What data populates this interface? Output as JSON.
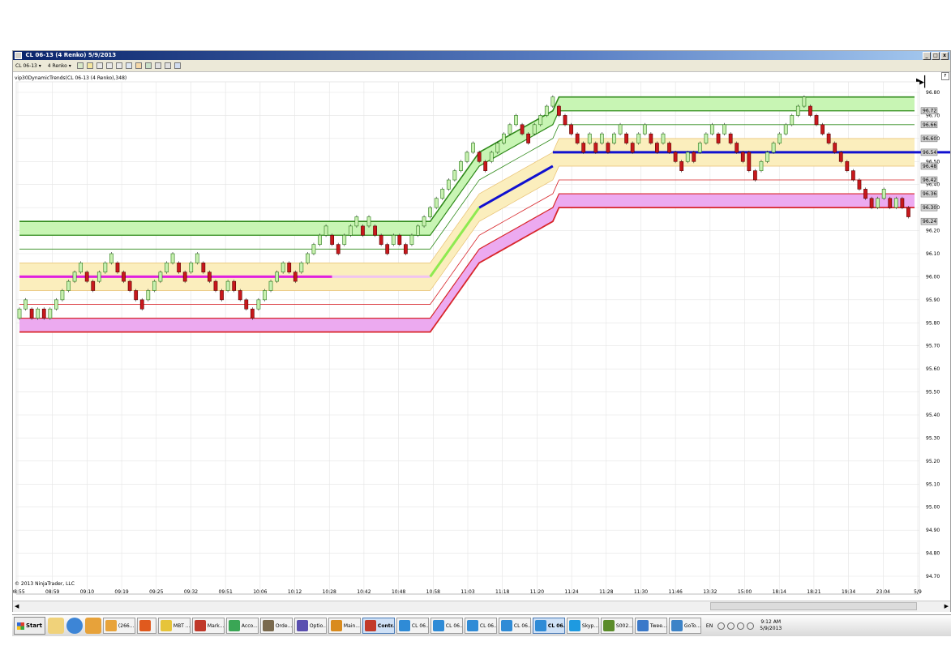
{
  "window": {
    "title": "CL 06-13 (4 Renko)  5/9/2013",
    "controls": [
      "_",
      "□",
      "x"
    ]
  },
  "toolbar": {
    "instrument": "CL 06-13 ▾",
    "bar_type": "4 Renko ▾"
  },
  "indicator_label": "vip30DynamicTrends(CL 06-13 (4 Renko),348)",
  "copyright": "© 2013 NinjaTrader, LLC",
  "nav": {
    "skip_to_end": "▶▏",
    "f_button": "F"
  },
  "taskbar": {
    "start_label": "Start",
    "items": [
      {
        "label": "(266...",
        "color": "#e8a33a"
      },
      {
        "label": "",
        "color": "#e05a1e"
      },
      {
        "label": "MBT ...",
        "color": "#e6c43a"
      },
      {
        "label": "Mark...",
        "color": "#c0392b"
      },
      {
        "label": "Acco...",
        "color": "#3aa655"
      },
      {
        "label": "Orde...",
        "color": "#7a6a4e"
      },
      {
        "label": "Optio...",
        "color": "#5a4fb0"
      },
      {
        "label": "Main...",
        "color": "#d98b1d"
      },
      {
        "label": "Contr...",
        "color": "#c23a2a",
        "active": true
      },
      {
        "label": "CL 06...",
        "color": "#2f8bd6"
      },
      {
        "label": "CL 06...",
        "color": "#2f8bd6"
      },
      {
        "label": "CL 06...",
        "color": "#2f8bd6"
      },
      {
        "label": "CL 06...",
        "color": "#2f8bd6"
      },
      {
        "label": "CL 06...",
        "color": "#2f8bd6",
        "active": true
      },
      {
        "label": "Skyp...",
        "color": "#1e9ae0"
      },
      {
        "label": "S002...",
        "color": "#5b8c2a"
      },
      {
        "label": "Twee...",
        "color": "#3b79c9"
      },
      {
        "label": "GoTo...",
        "color": "#3d83c7"
      }
    ],
    "tray_lang": "EN",
    "clock_time": "9:12 AM",
    "clock_date": "5/9/2013"
  },
  "chart_data": {
    "type": "renko",
    "box_size": 0.04,
    "ylim": [
      94.7,
      96.8
    ],
    "y_ticks": [
      96.8,
      96.7,
      96.6,
      96.5,
      96.4,
      96.3,
      96.2,
      96.1,
      96.0,
      95.9,
      95.8,
      95.7,
      95.6,
      95.5,
      95.4,
      95.3,
      95.2,
      95.1,
      95.0,
      94.9,
      94.8,
      94.7
    ],
    "x_tick_labels": [
      "08:55",
      "08:59",
      "09:10",
      "09:19",
      "09:25",
      "09:32",
      "09:51",
      "10:06",
      "10:12",
      "10:28",
      "10:42",
      "10:48",
      "10:58",
      "11:03",
      "11:18",
      "11:20",
      "11:24",
      "11:28",
      "11:30",
      "11:46",
      "13:32",
      "15:00",
      "18:14",
      "18:21",
      "19:34",
      "23:04",
      "5/9"
    ],
    "price_badges": [
      96.72,
      96.66,
      96.6,
      96.54,
      96.48,
      96.42,
      96.36,
      96.3,
      96.24
    ],
    "bars": [
      {
        "o": 95.82,
        "c": 95.86
      },
      {
        "o": 95.86,
        "c": 95.9
      },
      {
        "o": 95.86,
        "c": 95.82
      },
      {
        "o": 95.82,
        "c": 95.86
      },
      {
        "o": 95.86,
        "c": 95.82
      },
      {
        "o": 95.82,
        "c": 95.86
      },
      {
        "o": 95.86,
        "c": 95.9
      },
      {
        "o": 95.9,
        "c": 95.94
      },
      {
        "o": 95.94,
        "c": 95.98
      },
      {
        "o": 95.98,
        "c": 96.02
      },
      {
        "o": 96.02,
        "c": 96.06
      },
      {
        "o": 96.02,
        "c": 95.98
      },
      {
        "o": 95.98,
        "c": 95.94
      },
      {
        "o": 95.98,
        "c": 96.02
      },
      {
        "o": 96.02,
        "c": 96.06
      },
      {
        "o": 96.06,
        "c": 96.1
      },
      {
        "o": 96.06,
        "c": 96.02
      },
      {
        "o": 96.02,
        "c": 95.98
      },
      {
        "o": 95.98,
        "c": 95.94
      },
      {
        "o": 95.94,
        "c": 95.9
      },
      {
        "o": 95.9,
        "c": 95.86
      },
      {
        "o": 95.9,
        "c": 95.94
      },
      {
        "o": 95.94,
        "c": 95.98
      },
      {
        "o": 95.98,
        "c": 96.02
      },
      {
        "o": 96.02,
        "c": 96.06
      },
      {
        "o": 96.06,
        "c": 96.1
      },
      {
        "o": 96.06,
        "c": 96.02
      },
      {
        "o": 96.02,
        "c": 95.98
      },
      {
        "o": 96.02,
        "c": 96.06
      },
      {
        "o": 96.06,
        "c": 96.1
      },
      {
        "o": 96.06,
        "c": 96.02
      },
      {
        "o": 96.02,
        "c": 95.98
      },
      {
        "o": 95.98,
        "c": 95.94
      },
      {
        "o": 95.94,
        "c": 95.9
      },
      {
        "o": 95.94,
        "c": 95.98
      },
      {
        "o": 95.98,
        "c": 95.94
      },
      {
        "o": 95.94,
        "c": 95.9
      },
      {
        "o": 95.9,
        "c": 95.86
      },
      {
        "o": 95.86,
        "c": 95.82
      },
      {
        "o": 95.86,
        "c": 95.9
      },
      {
        "o": 95.9,
        "c": 95.94
      },
      {
        "o": 95.94,
        "c": 95.98
      },
      {
        "o": 95.98,
        "c": 96.02
      },
      {
        "o": 96.02,
        "c": 96.06
      },
      {
        "o": 96.06,
        "c": 96.02
      },
      {
        "o": 96.02,
        "c": 95.98
      },
      {
        "o": 96.02,
        "c": 96.06
      },
      {
        "o": 96.06,
        "c": 96.1
      },
      {
        "o": 96.1,
        "c": 96.14
      },
      {
        "o": 96.14,
        "c": 96.18
      },
      {
        "o": 96.18,
        "c": 96.22
      },
      {
        "o": 96.18,
        "c": 96.14
      },
      {
        "o": 96.14,
        "c": 96.1
      },
      {
        "o": 96.14,
        "c": 96.18
      },
      {
        "o": 96.18,
        "c": 96.22
      },
      {
        "o": 96.22,
        "c": 96.26
      },
      {
        "o": 96.22,
        "c": 96.18
      },
      {
        "o": 96.22,
        "c": 96.26
      },
      {
        "o": 96.22,
        "c": 96.18
      },
      {
        "o": 96.18,
        "c": 96.14
      },
      {
        "o": 96.14,
        "c": 96.1
      },
      {
        "o": 96.14,
        "c": 96.18
      },
      {
        "o": 96.18,
        "c": 96.14
      },
      {
        "o": 96.14,
        "c": 96.1
      },
      {
        "o": 96.14,
        "c": 96.18
      },
      {
        "o": 96.18,
        "c": 96.22
      },
      {
        "o": 96.22,
        "c": 96.26
      },
      {
        "o": 96.26,
        "c": 96.3
      },
      {
        "o": 96.3,
        "c": 96.34
      },
      {
        "o": 96.34,
        "c": 96.38
      },
      {
        "o": 96.38,
        "c": 96.42
      },
      {
        "o": 96.42,
        "c": 96.46
      },
      {
        "o": 96.46,
        "c": 96.5
      },
      {
        "o": 96.5,
        "c": 96.54
      },
      {
        "o": 96.54,
        "c": 96.58
      },
      {
        "o": 96.54,
        "c": 96.5
      },
      {
        "o": 96.5,
        "c": 96.46
      },
      {
        "o": 96.5,
        "c": 96.54
      },
      {
        "o": 96.54,
        "c": 96.58
      },
      {
        "o": 96.58,
        "c": 96.62
      },
      {
        "o": 96.62,
        "c": 96.66
      },
      {
        "o": 96.66,
        "c": 96.7
      },
      {
        "o": 96.66,
        "c": 96.62
      },
      {
        "o": 96.62,
        "c": 96.58
      },
      {
        "o": 96.62,
        "c": 96.66
      },
      {
        "o": 96.66,
        "c": 96.7
      },
      {
        "o": 96.7,
        "c": 96.74
      },
      {
        "o": 96.74,
        "c": 96.78
      },
      {
        "o": 96.74,
        "c": 96.7
      },
      {
        "o": 96.7,
        "c": 96.66
      },
      {
        "o": 96.66,
        "c": 96.62
      },
      {
        "o": 96.62,
        "c": 96.58
      },
      {
        "o": 96.58,
        "c": 96.54
      },
      {
        "o": 96.58,
        "c": 96.62
      },
      {
        "o": 96.58,
        "c": 96.54
      },
      {
        "o": 96.58,
        "c": 96.62
      },
      {
        "o": 96.58,
        "c": 96.54
      },
      {
        "o": 96.58,
        "c": 96.62
      },
      {
        "o": 96.62,
        "c": 96.66
      },
      {
        "o": 96.62,
        "c": 96.58
      },
      {
        "o": 96.58,
        "c": 96.54
      },
      {
        "o": 96.58,
        "c": 96.62
      },
      {
        "o": 96.62,
        "c": 96.66
      },
      {
        "o": 96.62,
        "c": 96.58
      },
      {
        "o": 96.58,
        "c": 96.54
      },
      {
        "o": 96.58,
        "c": 96.62
      },
      {
        "o": 96.58,
        "c": 96.54
      },
      {
        "o": 96.54,
        "c": 96.5
      },
      {
        "o": 96.5,
        "c": 96.46
      },
      {
        "o": 96.5,
        "c": 96.54
      },
      {
        "o": 96.54,
        "c": 96.5
      },
      {
        "o": 96.54,
        "c": 96.58
      },
      {
        "o": 96.58,
        "c": 96.62
      },
      {
        "o": 96.62,
        "c": 96.66
      },
      {
        "o": 96.62,
        "c": 96.58
      },
      {
        "o": 96.62,
        "c": 96.66
      },
      {
        "o": 96.62,
        "c": 96.58
      },
      {
        "o": 96.58,
        "c": 96.54
      },
      {
        "o": 96.54,
        "c": 96.5
      },
      {
        "o": 96.54,
        "c": 96.46
      },
      {
        "o": 96.46,
        "c": 96.42
      },
      {
        "o": 96.46,
        "c": 96.5
      },
      {
        "o": 96.5,
        "c": 96.54
      },
      {
        "o": 96.54,
        "c": 96.58
      },
      {
        "o": 96.58,
        "c": 96.62
      },
      {
        "o": 96.62,
        "c": 96.66
      },
      {
        "o": 96.66,
        "c": 96.7
      },
      {
        "o": 96.7,
        "c": 96.74
      },
      {
        "o": 96.74,
        "c": 96.78
      },
      {
        "o": 96.74,
        "c": 96.7
      },
      {
        "o": 96.7,
        "c": 96.66
      },
      {
        "o": 96.66,
        "c": 96.62
      },
      {
        "o": 96.62,
        "c": 96.58
      },
      {
        "o": 96.58,
        "c": 96.54
      },
      {
        "o": 96.54,
        "c": 96.5
      },
      {
        "o": 96.5,
        "c": 96.46
      },
      {
        "o": 96.46,
        "c": 96.42
      },
      {
        "o": 96.42,
        "c": 96.38
      },
      {
        "o": 96.38,
        "c": 96.34
      },
      {
        "o": 96.34,
        "c": 96.3
      },
      {
        "o": 96.3,
        "c": 96.34
      },
      {
        "o": 96.34,
        "c": 96.38
      },
      {
        "o": 96.34,
        "c": 96.3
      },
      {
        "o": 96.3,
        "c": 96.34
      },
      {
        "o": 96.34,
        "c": 96.3
      },
      {
        "o": 96.3,
        "c": 96.26
      }
    ],
    "trend_segments": [
      {
        "x": [
          0,
          51
        ],
        "mid": 96.0,
        "color": "#e020e0"
      },
      {
        "x": [
          51,
          67
        ],
        "mid": 96.0,
        "color": "#f0c4f0"
      },
      {
        "x": [
          67,
          75
        ],
        "mid": [
          96.0,
          96.3
        ],
        "color": "#8eea50"
      },
      {
        "x": [
          75,
          87
        ],
        "mid": [
          96.3,
          96.48
        ],
        "color": "#1010d0"
      },
      {
        "x": [
          87,
          163
        ],
        "mid": 96.54,
        "color": "#1010d0"
      },
      {
        "x": [
          163,
          170
        ],
        "mid": 96.54,
        "color": "#f2d24a"
      }
    ],
    "grid": true
  }
}
